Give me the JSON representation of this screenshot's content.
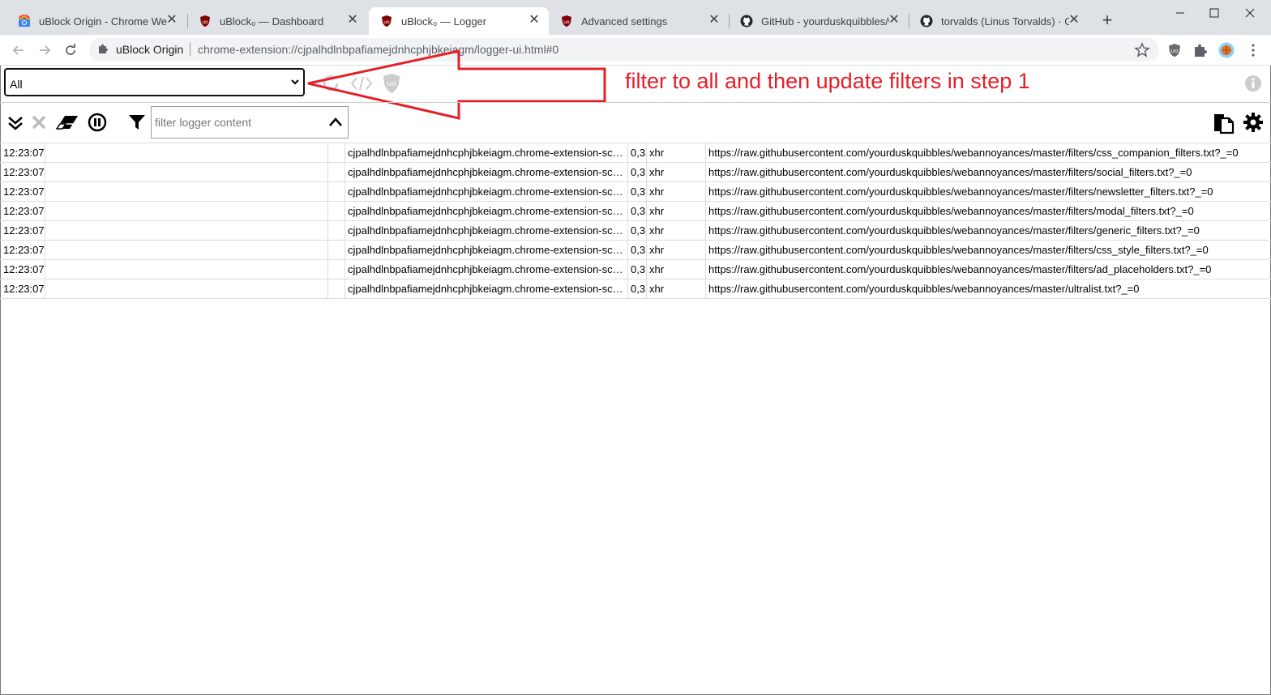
{
  "browser": {
    "tabs": [
      {
        "title": "uBlock Origin - Chrome Web Store",
        "close": "✕"
      },
      {
        "title": "uBlock₀ — Dashboard",
        "close": "✕"
      },
      {
        "title": "uBlock₀ — Logger",
        "close": "✕"
      },
      {
        "title": "Advanced settings",
        "close": "✕"
      },
      {
        "title": "GitHub - yourduskquibbles/webannoyances",
        "close": "✕"
      },
      {
        "title": "torvalds (Linus Torvalds) · GitHub",
        "close": "✕"
      }
    ],
    "new_tab": "+",
    "omnibox": {
      "origin": "uBlock Origin",
      "url": "chrome-extension://cjpalhdlnbpafiamejdnhcphjbkeiagm/logger-ui.html#0"
    },
    "colors": {
      "tabstrip": "#dee1e6",
      "ublock_red": "#800000"
    }
  },
  "logger": {
    "tab_select": {
      "selected": "All"
    },
    "annotation": "filter to all and then update filters in step 1",
    "annotation_color": "#e3202a",
    "filter_input": {
      "placeholder": "filter logger content"
    },
    "rows": [
      {
        "time": "12:23:07",
        "context": "cjpalhdlnbpafiamejdnhcphjbkeiagm.chrome-extension-scheme",
        "party": "0,3",
        "type": "xhr",
        "url": "https://raw.githubusercontent.com/yourduskquibbles/webannoyances/master/filters/css_companion_filters.txt?_=0"
      },
      {
        "time": "12:23:07",
        "context": "cjpalhdlnbpafiamejdnhcphjbkeiagm.chrome-extension-scheme",
        "party": "0,3",
        "type": "xhr",
        "url": "https://raw.githubusercontent.com/yourduskquibbles/webannoyances/master/filters/social_filters.txt?_=0"
      },
      {
        "time": "12:23:07",
        "context": "cjpalhdlnbpafiamejdnhcphjbkeiagm.chrome-extension-scheme",
        "party": "0,3",
        "type": "xhr",
        "url": "https://raw.githubusercontent.com/yourduskquibbles/webannoyances/master/filters/newsletter_filters.txt?_=0"
      },
      {
        "time": "12:23:07",
        "context": "cjpalhdlnbpafiamejdnhcphjbkeiagm.chrome-extension-scheme",
        "party": "0,3",
        "type": "xhr",
        "url": "https://raw.githubusercontent.com/yourduskquibbles/webannoyances/master/filters/modal_filters.txt?_=0"
      },
      {
        "time": "12:23:07",
        "context": "cjpalhdlnbpafiamejdnhcphjbkeiagm.chrome-extension-scheme",
        "party": "0,3",
        "type": "xhr",
        "url": "https://raw.githubusercontent.com/yourduskquibbles/webannoyances/master/filters/generic_filters.txt?_=0"
      },
      {
        "time": "12:23:07",
        "context": "cjpalhdlnbpafiamejdnhcphjbkeiagm.chrome-extension-scheme",
        "party": "0,3",
        "type": "xhr",
        "url": "https://raw.githubusercontent.com/yourduskquibbles/webannoyances/master/filters/css_style_filters.txt?_=0"
      },
      {
        "time": "12:23:07",
        "context": "cjpalhdlnbpafiamejdnhcphjbkeiagm.chrome-extension-scheme",
        "party": "0,3",
        "type": "xhr",
        "url": "https://raw.githubusercontent.com/yourduskquibbles/webannoyances/master/filters/ad_placeholders.txt?_=0"
      },
      {
        "time": "12:23:07",
        "context": "cjpalhdlnbpafiamejdnhcphjbkeiagm.chrome-extension-scheme",
        "party": "0,3",
        "type": "xhr",
        "url": "https://raw.githubusercontent.com/yourduskquibbles/webannoyances/master/ultralist.txt?_=0"
      }
    ]
  }
}
